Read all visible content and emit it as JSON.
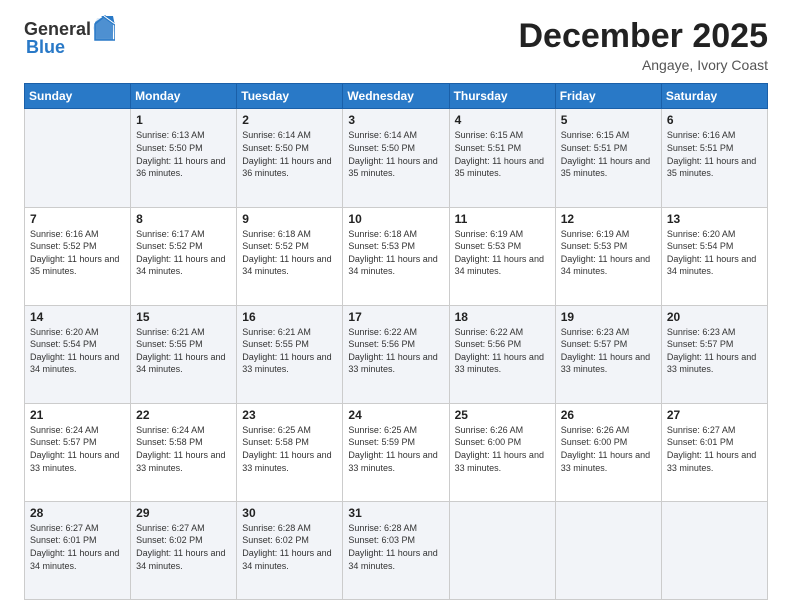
{
  "logo": {
    "general": "General",
    "blue": "Blue"
  },
  "header": {
    "month": "December 2025",
    "location": "Angaye, Ivory Coast"
  },
  "weekdays": [
    "Sunday",
    "Monday",
    "Tuesday",
    "Wednesday",
    "Thursday",
    "Friday",
    "Saturday"
  ],
  "weeks": [
    [
      {
        "day": "",
        "sunrise": "",
        "sunset": "",
        "daylight": ""
      },
      {
        "day": "1",
        "sunrise": "Sunrise: 6:13 AM",
        "sunset": "Sunset: 5:50 PM",
        "daylight": "Daylight: 11 hours and 36 minutes."
      },
      {
        "day": "2",
        "sunrise": "Sunrise: 6:14 AM",
        "sunset": "Sunset: 5:50 PM",
        "daylight": "Daylight: 11 hours and 36 minutes."
      },
      {
        "day": "3",
        "sunrise": "Sunrise: 6:14 AM",
        "sunset": "Sunset: 5:50 PM",
        "daylight": "Daylight: 11 hours and 35 minutes."
      },
      {
        "day": "4",
        "sunrise": "Sunrise: 6:15 AM",
        "sunset": "Sunset: 5:51 PM",
        "daylight": "Daylight: 11 hours and 35 minutes."
      },
      {
        "day": "5",
        "sunrise": "Sunrise: 6:15 AM",
        "sunset": "Sunset: 5:51 PM",
        "daylight": "Daylight: 11 hours and 35 minutes."
      },
      {
        "day": "6",
        "sunrise": "Sunrise: 6:16 AM",
        "sunset": "Sunset: 5:51 PM",
        "daylight": "Daylight: 11 hours and 35 minutes."
      }
    ],
    [
      {
        "day": "7",
        "sunrise": "Sunrise: 6:16 AM",
        "sunset": "Sunset: 5:52 PM",
        "daylight": "Daylight: 11 hours and 35 minutes."
      },
      {
        "day": "8",
        "sunrise": "Sunrise: 6:17 AM",
        "sunset": "Sunset: 5:52 PM",
        "daylight": "Daylight: 11 hours and 34 minutes."
      },
      {
        "day": "9",
        "sunrise": "Sunrise: 6:18 AM",
        "sunset": "Sunset: 5:52 PM",
        "daylight": "Daylight: 11 hours and 34 minutes."
      },
      {
        "day": "10",
        "sunrise": "Sunrise: 6:18 AM",
        "sunset": "Sunset: 5:53 PM",
        "daylight": "Daylight: 11 hours and 34 minutes."
      },
      {
        "day": "11",
        "sunrise": "Sunrise: 6:19 AM",
        "sunset": "Sunset: 5:53 PM",
        "daylight": "Daylight: 11 hours and 34 minutes."
      },
      {
        "day": "12",
        "sunrise": "Sunrise: 6:19 AM",
        "sunset": "Sunset: 5:53 PM",
        "daylight": "Daylight: 11 hours and 34 minutes."
      },
      {
        "day": "13",
        "sunrise": "Sunrise: 6:20 AM",
        "sunset": "Sunset: 5:54 PM",
        "daylight": "Daylight: 11 hours and 34 minutes."
      }
    ],
    [
      {
        "day": "14",
        "sunrise": "Sunrise: 6:20 AM",
        "sunset": "Sunset: 5:54 PM",
        "daylight": "Daylight: 11 hours and 34 minutes."
      },
      {
        "day": "15",
        "sunrise": "Sunrise: 6:21 AM",
        "sunset": "Sunset: 5:55 PM",
        "daylight": "Daylight: 11 hours and 34 minutes."
      },
      {
        "day": "16",
        "sunrise": "Sunrise: 6:21 AM",
        "sunset": "Sunset: 5:55 PM",
        "daylight": "Daylight: 11 hours and 33 minutes."
      },
      {
        "day": "17",
        "sunrise": "Sunrise: 6:22 AM",
        "sunset": "Sunset: 5:56 PM",
        "daylight": "Daylight: 11 hours and 33 minutes."
      },
      {
        "day": "18",
        "sunrise": "Sunrise: 6:22 AM",
        "sunset": "Sunset: 5:56 PM",
        "daylight": "Daylight: 11 hours and 33 minutes."
      },
      {
        "day": "19",
        "sunrise": "Sunrise: 6:23 AM",
        "sunset": "Sunset: 5:57 PM",
        "daylight": "Daylight: 11 hours and 33 minutes."
      },
      {
        "day": "20",
        "sunrise": "Sunrise: 6:23 AM",
        "sunset": "Sunset: 5:57 PM",
        "daylight": "Daylight: 11 hours and 33 minutes."
      }
    ],
    [
      {
        "day": "21",
        "sunrise": "Sunrise: 6:24 AM",
        "sunset": "Sunset: 5:57 PM",
        "daylight": "Daylight: 11 hours and 33 minutes."
      },
      {
        "day": "22",
        "sunrise": "Sunrise: 6:24 AM",
        "sunset": "Sunset: 5:58 PM",
        "daylight": "Daylight: 11 hours and 33 minutes."
      },
      {
        "day": "23",
        "sunrise": "Sunrise: 6:25 AM",
        "sunset": "Sunset: 5:58 PM",
        "daylight": "Daylight: 11 hours and 33 minutes."
      },
      {
        "day": "24",
        "sunrise": "Sunrise: 6:25 AM",
        "sunset": "Sunset: 5:59 PM",
        "daylight": "Daylight: 11 hours and 33 minutes."
      },
      {
        "day": "25",
        "sunrise": "Sunrise: 6:26 AM",
        "sunset": "Sunset: 6:00 PM",
        "daylight": "Daylight: 11 hours and 33 minutes."
      },
      {
        "day": "26",
        "sunrise": "Sunrise: 6:26 AM",
        "sunset": "Sunset: 6:00 PM",
        "daylight": "Daylight: 11 hours and 33 minutes."
      },
      {
        "day": "27",
        "sunrise": "Sunrise: 6:27 AM",
        "sunset": "Sunset: 6:01 PM",
        "daylight": "Daylight: 11 hours and 33 minutes."
      }
    ],
    [
      {
        "day": "28",
        "sunrise": "Sunrise: 6:27 AM",
        "sunset": "Sunset: 6:01 PM",
        "daylight": "Daylight: 11 hours and 34 minutes."
      },
      {
        "day": "29",
        "sunrise": "Sunrise: 6:27 AM",
        "sunset": "Sunset: 6:02 PM",
        "daylight": "Daylight: 11 hours and 34 minutes."
      },
      {
        "day": "30",
        "sunrise": "Sunrise: 6:28 AM",
        "sunset": "Sunset: 6:02 PM",
        "daylight": "Daylight: 11 hours and 34 minutes."
      },
      {
        "day": "31",
        "sunrise": "Sunrise: 6:28 AM",
        "sunset": "Sunset: 6:03 PM",
        "daylight": "Daylight: 11 hours and 34 minutes."
      },
      {
        "day": "",
        "sunrise": "",
        "sunset": "",
        "daylight": ""
      },
      {
        "day": "",
        "sunrise": "",
        "sunset": "",
        "daylight": ""
      },
      {
        "day": "",
        "sunrise": "",
        "sunset": "",
        "daylight": ""
      }
    ]
  ]
}
